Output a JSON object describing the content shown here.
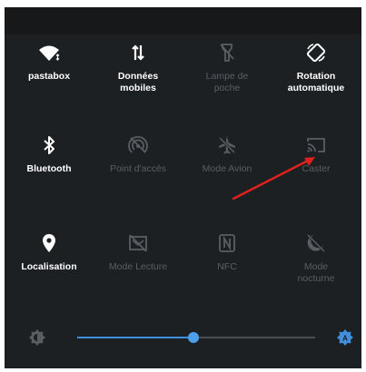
{
  "quick_settings": {
    "tiles": [
      {
        "label": "pastabox",
        "state": "on",
        "icon": "wifi-icon"
      },
      {
        "label": "Données\nmobiles",
        "state": "on",
        "icon": "mobile-data-icon"
      },
      {
        "label": "Lampe de\npoche",
        "state": "off",
        "icon": "flashlight-icon"
      },
      {
        "label": "Rotation\nautomatique",
        "state": "on",
        "icon": "auto-rotate-icon"
      },
      {
        "label": "Bluetooth",
        "state": "on",
        "icon": "bluetooth-icon"
      },
      {
        "label": "Point d'accès",
        "state": "off",
        "icon": "hotspot-icon"
      },
      {
        "label": "Mode Avion",
        "state": "off",
        "icon": "airplane-icon"
      },
      {
        "label": "Caster",
        "state": "off",
        "icon": "cast-icon"
      },
      {
        "label": "Localisation",
        "state": "on",
        "icon": "location-icon"
      },
      {
        "label": "Mode Lecture",
        "state": "off",
        "icon": "reading-mode-icon"
      },
      {
        "label": "NFC",
        "state": "off",
        "icon": "nfc-icon"
      },
      {
        "label": "Mode\nnocturne",
        "state": "off",
        "icon": "night-mode-icon"
      }
    ]
  },
  "brightness": {
    "level": 0.49,
    "auto": true,
    "icon": "brightness-icon",
    "auto_icon": "auto-brightness-icon"
  },
  "annotation": {
    "type": "arrow",
    "color": "#e0201c",
    "points_to": "Caster"
  },
  "colors": {
    "panel_bg": "#1d2023",
    "active": "#ffffff",
    "inactive": "#5a5e62",
    "accent": "#3f8fdc"
  }
}
